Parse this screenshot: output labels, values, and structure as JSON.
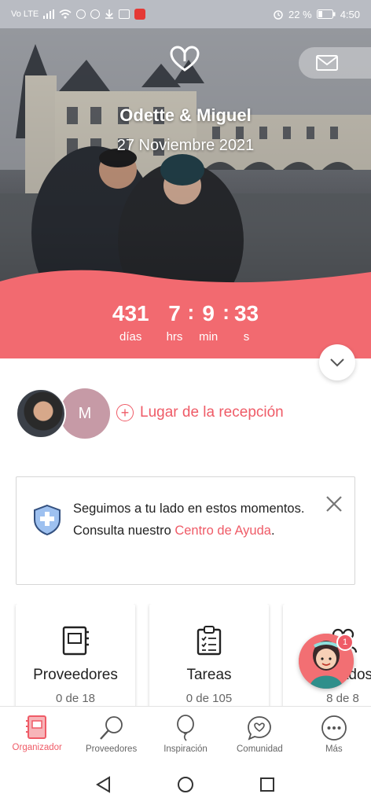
{
  "status_bar": {
    "left_text": "Vo LTE",
    "battery": "22 %",
    "time": "4:50"
  },
  "hero": {
    "couple_name": "Odette & Miguel",
    "wedding_date": "27 Noviembre 2021",
    "icons": {
      "logo": "heart-logo-icon",
      "mail": "envelope-icon"
    }
  },
  "countdown": {
    "days": "431",
    "days_label": "días",
    "hours": "7",
    "hours_label": "hrs",
    "minutes": "9",
    "minutes_label": "min",
    "seconds": "33",
    "seconds_label": "s",
    "separator": ":"
  },
  "partners": {
    "second_initial": "M",
    "add_venue_label": "Lugar de la recepción"
  },
  "notice": {
    "text": "Seguimos a tu lado en estos momentos. Consulta nuestro ",
    "link": "Centro de Ayuda",
    "end": "."
  },
  "cards": [
    {
      "title": "Proveedores",
      "count": "0 de 18",
      "icon": "notebook-icon"
    },
    {
      "title": "Tareas",
      "count": "0 de 105",
      "icon": "clipboard-icon"
    },
    {
      "title": "Invitados",
      "count": "8 de 8",
      "icon": "guests-icon"
    }
  ],
  "fab": {
    "badge": "1"
  },
  "bottom_nav": [
    {
      "label": "Organizador",
      "icon": "planner-icon",
      "active": true
    },
    {
      "label": "Proveedores",
      "icon": "search-icon",
      "active": false
    },
    {
      "label": "Inspiración",
      "icon": "balloon-icon",
      "active": false
    },
    {
      "label": "Comunidad",
      "icon": "chat-heart-icon",
      "active": false
    },
    {
      "label": "Más",
      "icon": "more-icon",
      "active": false
    }
  ],
  "colors": {
    "accent": "#ef5b67",
    "countdown_bg": "#f26a70",
    "avatar_m": "#c69aa6"
  }
}
